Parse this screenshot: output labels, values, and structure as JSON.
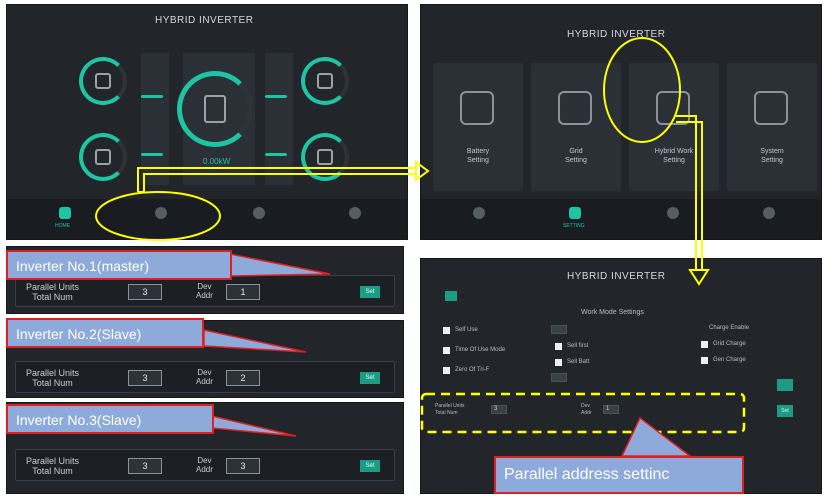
{
  "header_title": "HYBRID INVERTER",
  "screen1": {
    "display_value": "0.00kW",
    "nav": [
      "HOME",
      "",
      "",
      ""
    ]
  },
  "screen2": {
    "cards": [
      {
        "label_line1": "Battery",
        "label_line2": "Setting"
      },
      {
        "label_line1": "Grid",
        "label_line2": "Setting"
      },
      {
        "label_line1": "Hybrid Work",
        "label_line2": "Setting"
      },
      {
        "label_line1": "System",
        "label_line2": "Setting"
      }
    ],
    "nav_active": "SETTING"
  },
  "screen3": {
    "section_title": "Work Mode Settings",
    "options_left": [
      "Self Use",
      "Time Of Use Mode",
      "Zero Of Tri-F"
    ],
    "options_mid": [
      "Sell first",
      "Sell Batt"
    ],
    "group_title": "Charge Enable",
    "group_options": [
      "Grid Charge",
      "Gen Charge"
    ],
    "parallel_label": "Parallel Units Total Num",
    "parallel_value": "3",
    "addr_label": "Dev Addr",
    "addr_value": "1",
    "set_label": "Set"
  },
  "inverters": [
    {
      "callout": "Inverter No.1(master)",
      "units_label_1": "Parallel Units",
      "units_label_2": "Total Num",
      "units_value": "3",
      "addr_label_1": "Dev",
      "addr_label_2": "Addr",
      "addr_value": "1",
      "set": "Set"
    },
    {
      "callout": "Inverter No.2(Slave)",
      "units_label_1": "Parallel Units",
      "units_label_2": "Total Num",
      "units_value": "3",
      "addr_label_1": "Dev",
      "addr_label_2": "Addr",
      "addr_value": "2",
      "set": "Set"
    },
    {
      "callout": "Inverter  No.3(Slave)",
      "units_label_1": "Parallel Units",
      "units_label_2": "Total Num",
      "units_value": "3",
      "addr_label_1": "Dev",
      "addr_label_2": "Addr",
      "addr_value": "3",
      "set": "Set"
    }
  ],
  "bottom_callout": "Parallel address settinc",
  "colors": {
    "accent": "#1ec4a4",
    "callout_fill": "#8eaadb",
    "callout_border": "#e02020",
    "highlight": "#ffff00"
  }
}
